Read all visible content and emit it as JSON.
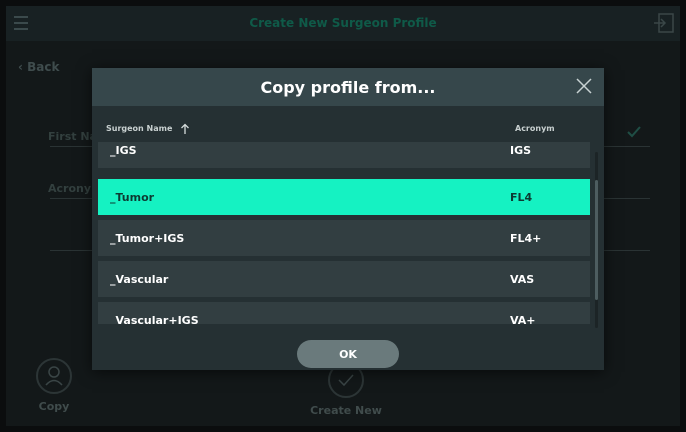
{
  "header": {
    "title": "Create New Surgeon Profile"
  },
  "nav": {
    "back_label": "Back"
  },
  "form": {
    "first_name_label": "First Na",
    "acronym_label": "Acrony"
  },
  "bottom": {
    "copy_label": "Copy",
    "create_new_label": "Create New"
  },
  "dialog": {
    "title": "Copy profile from...",
    "col_name": "Surgeon Name",
    "col_acronym": "Acronym",
    "ok_label": "OK",
    "rows": [
      {
        "name": "_IGS",
        "acronym": "IGS",
        "selected": false
      },
      {
        "name": "_Tumor",
        "acronym": "FL4",
        "selected": true
      },
      {
        "name": "_Tumor+IGS",
        "acronym": "FL4+",
        "selected": false
      },
      {
        "name": "_Vascular",
        "acronym": "VAS",
        "selected": false
      },
      {
        "name": "_Vascular+IGS",
        "acronym": "VA+",
        "selected": false
      }
    ]
  },
  "colors": {
    "accent": "#15f2c2",
    "header": "#36474b",
    "dialog_bg": "#253033",
    "row_bg": "#323e41",
    "ok_button": "#6a7a7c"
  },
  "icons": {
    "menu": "menu-icon",
    "exit": "exit-icon",
    "back": "chevron-left-icon",
    "close": "close-icon",
    "sort": "sort-ascending-icon",
    "copy": "person-icon",
    "create": "check-circle-icon"
  }
}
